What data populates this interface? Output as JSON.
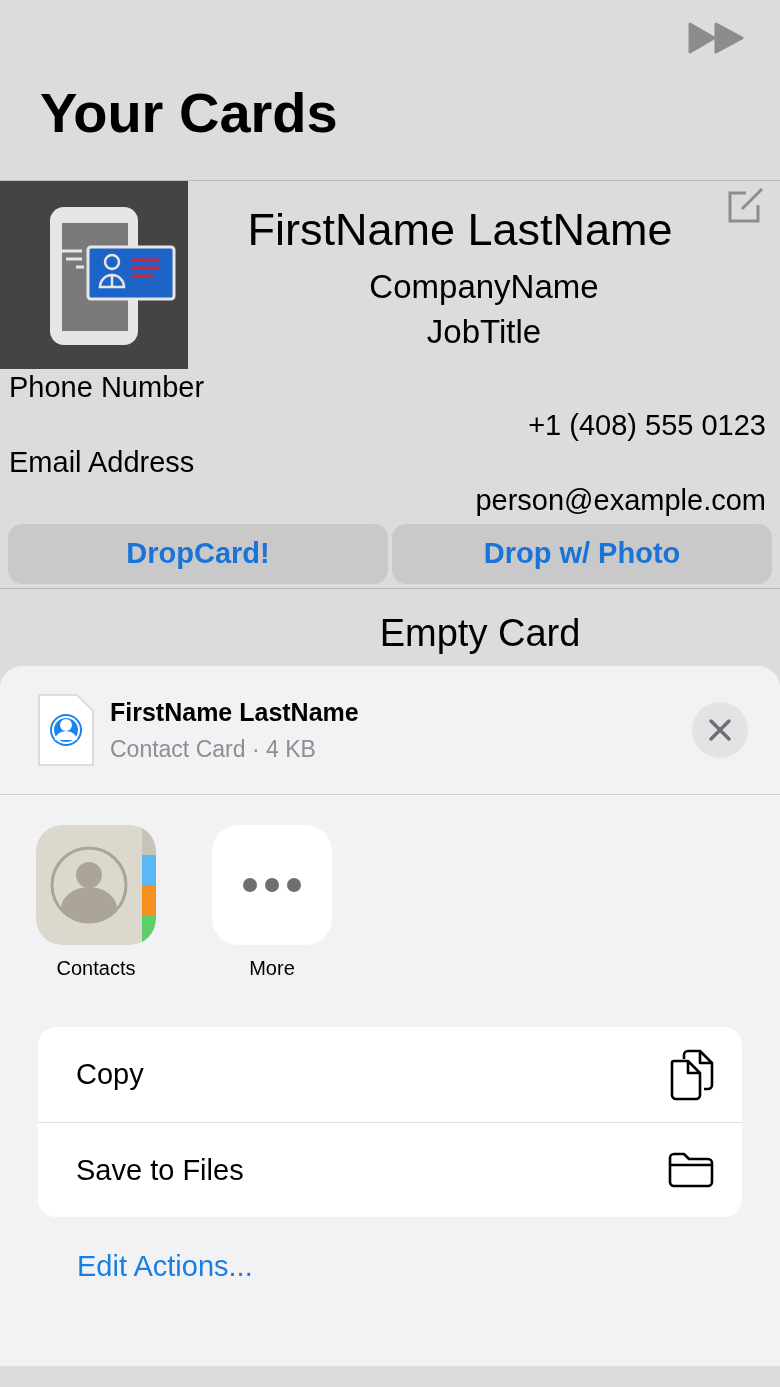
{
  "header": {
    "title": "Your Cards"
  },
  "card": {
    "name": "FirstName LastName",
    "company": "CompanyName",
    "job_title": "JobTitle",
    "fields": [
      {
        "label": "Phone Number",
        "value": "+1 (408) 555 0123"
      },
      {
        "label": "Email Address",
        "value": "person@example.com"
      }
    ],
    "buttons": [
      "DropCard!",
      "Drop w/ Photo"
    ]
  },
  "next_card": {
    "title": "Empty Card"
  },
  "share_sheet": {
    "file_name": "FirstName LastName",
    "file_info": "Contact Card · 4 KB",
    "apps": [
      {
        "kind": "contacts",
        "label": "Contacts"
      },
      {
        "kind": "more",
        "label": "More"
      }
    ],
    "actions": [
      {
        "kind": "copy",
        "label": "Copy"
      },
      {
        "kind": "files",
        "label": "Save to Files"
      }
    ],
    "edit_link": "Edit Actions..."
  }
}
